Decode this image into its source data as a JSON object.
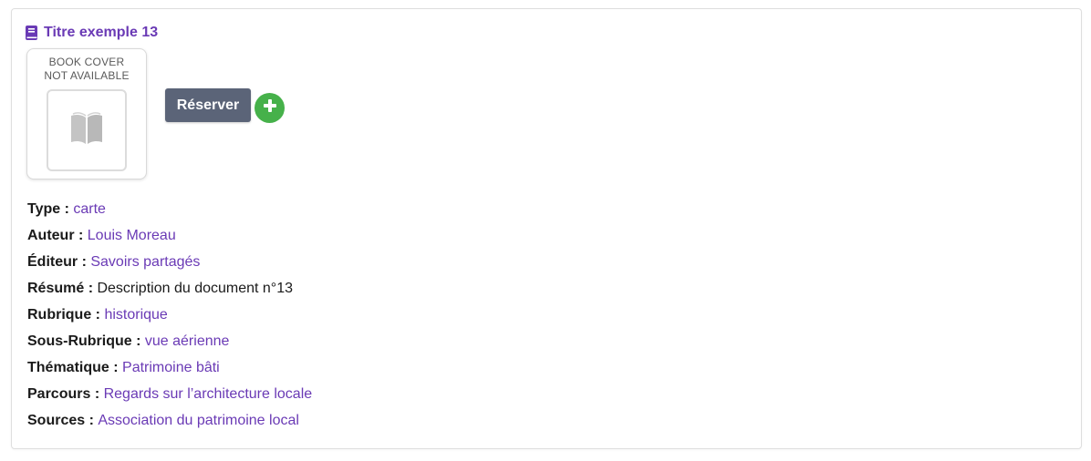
{
  "record": {
    "title": "Titre exemple 13",
    "cover": {
      "line1": "BOOK COVER",
      "line2": "NOT AVAILABLE",
      "icon": "open-book-icon"
    },
    "actions": {
      "reserve_label": "Réserver",
      "add_icon": "plus-icon"
    },
    "fields": {
      "type": {
        "label": "Type : ",
        "value": "carte"
      },
      "auteur": {
        "label": "Auteur : ",
        "value": "Louis Moreau"
      },
      "editeur": {
        "label": "Éditeur : ",
        "value": "Savoirs partagés"
      },
      "resume": {
        "label": "Résumé : ",
        "value": "Description du document n°13"
      },
      "rubrique": {
        "label": "Rubrique : ",
        "value": "historique"
      },
      "sous_rubrique": {
        "label": "Sous-Rubrique : ",
        "value": "vue aérienne"
      },
      "thematique": {
        "label": "Thématique : ",
        "value": "Patrimoine bâti"
      },
      "parcours": {
        "label": "Parcours : ",
        "value": "Regards sur l’architecture locale"
      },
      "sources": {
        "label": "Sources : ",
        "value": "Association du patrimoine local"
      }
    }
  },
  "colors": {
    "accent": "#6a3ab5",
    "reserve_button": "#5b6478",
    "add_button": "#46b14a"
  }
}
